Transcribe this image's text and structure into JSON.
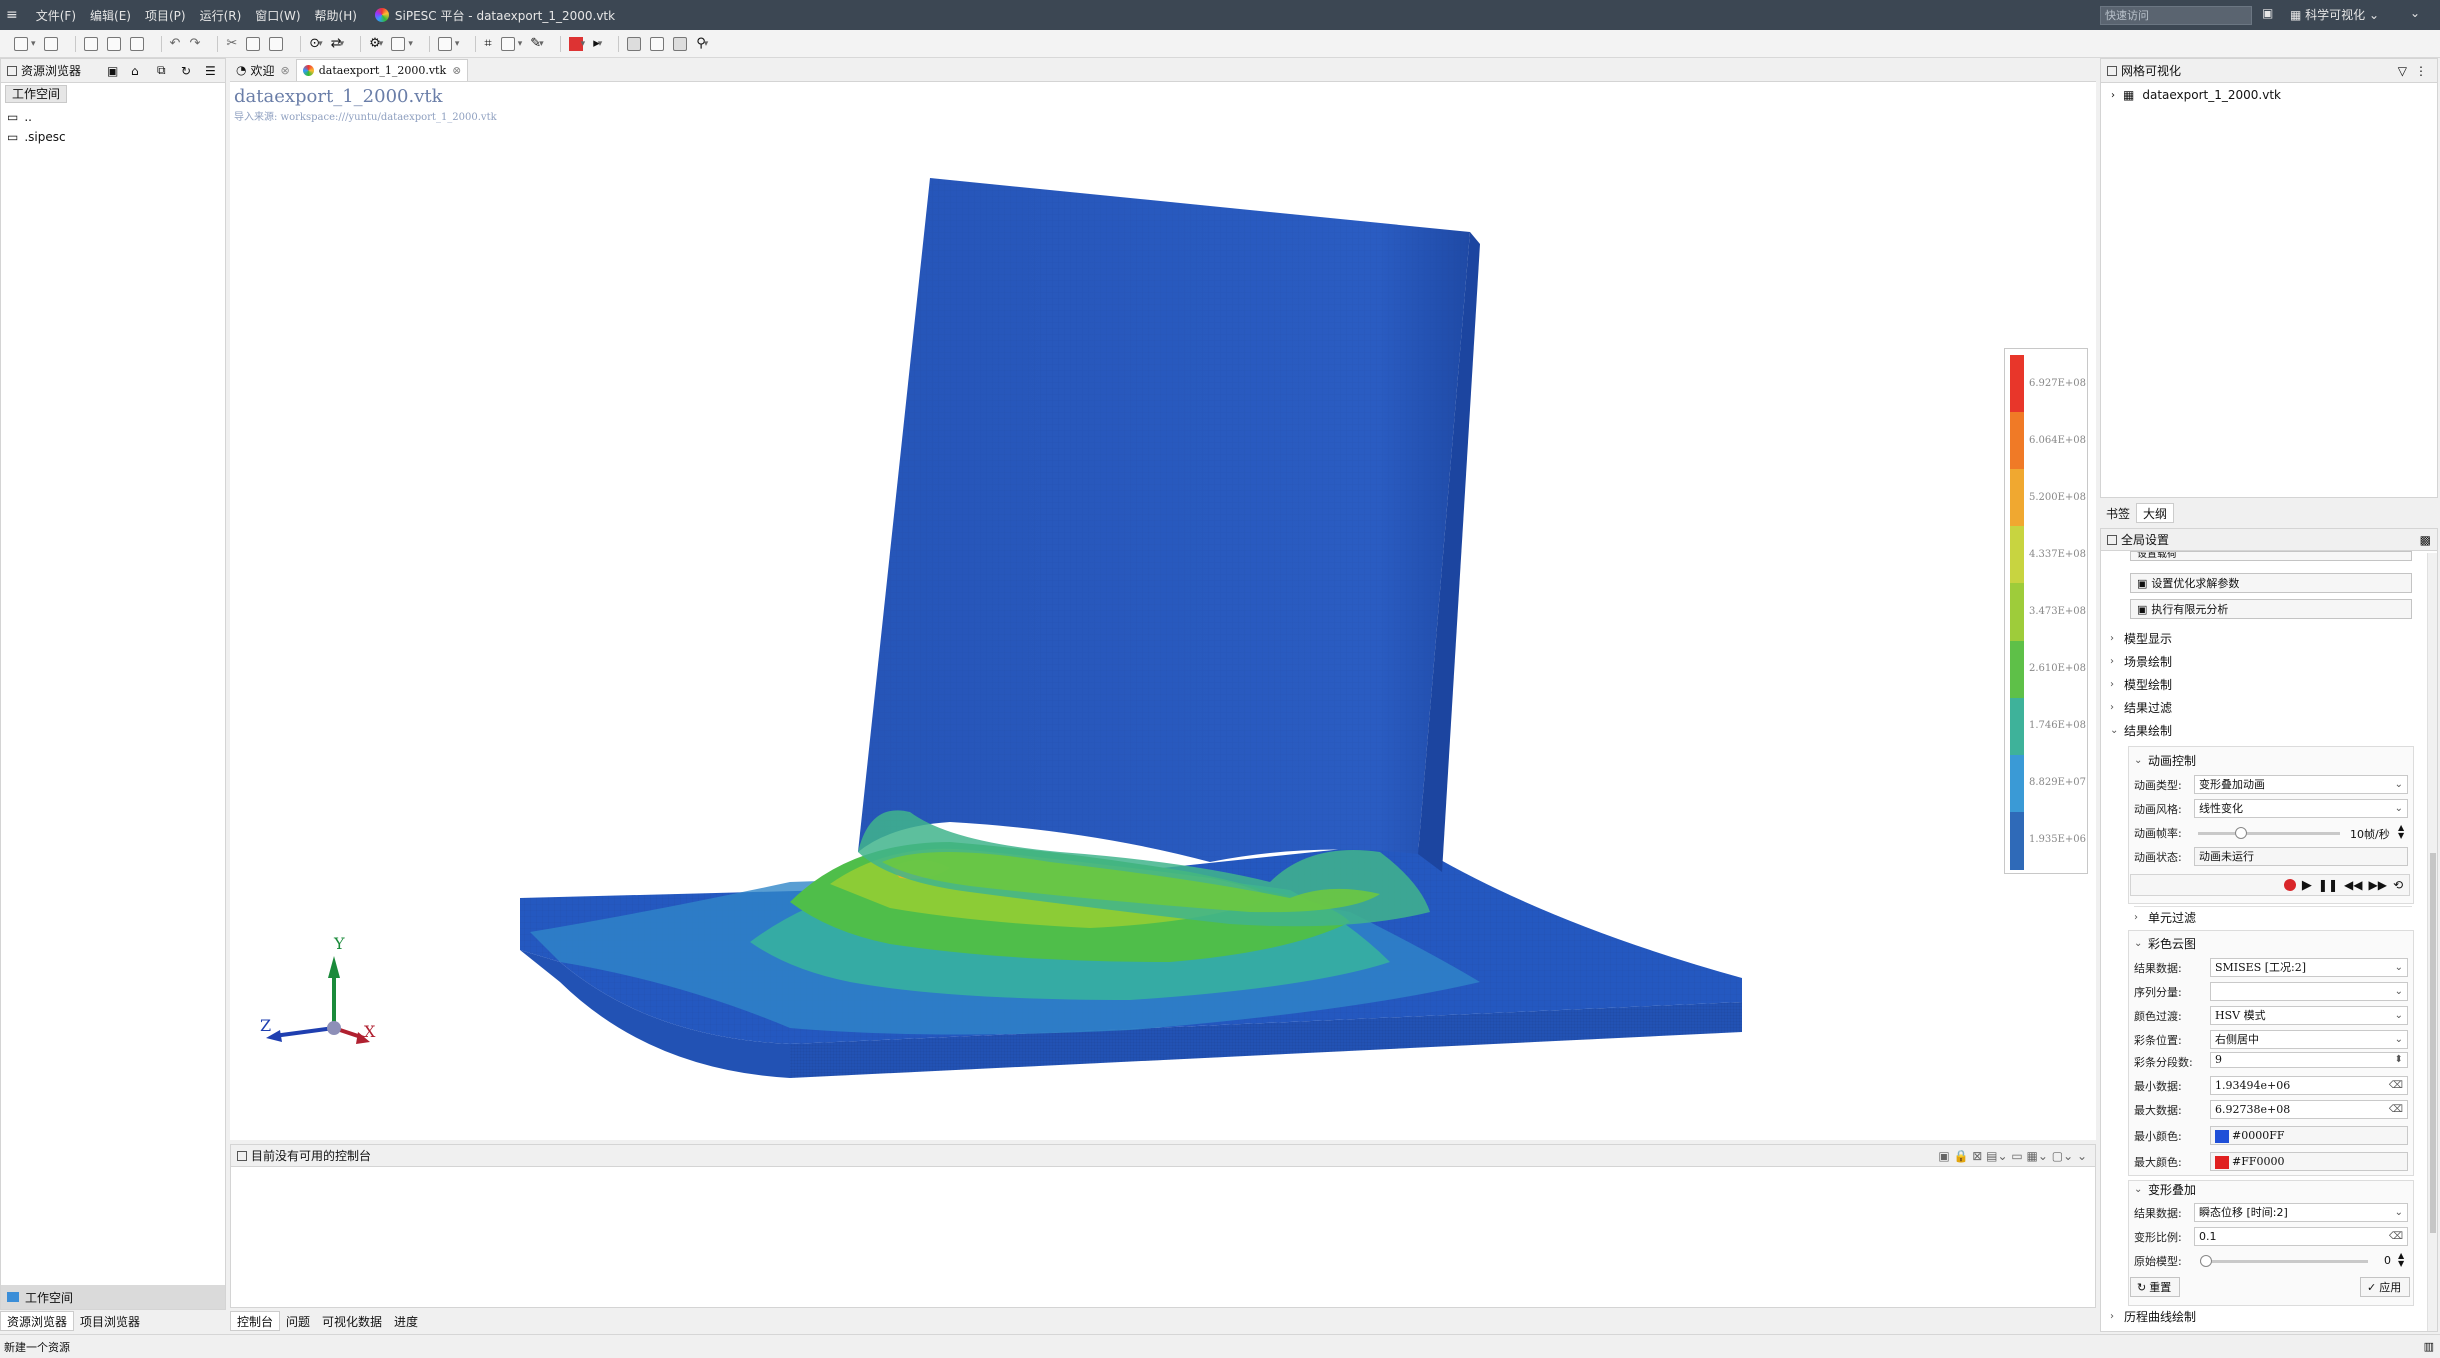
{
  "titlebar": {
    "menus": [
      "文件(F)",
      "编辑(E)",
      "项目(P)",
      "运行(R)",
      "窗口(W)",
      "帮助(H)"
    ],
    "title": "SiPESC 平台 - dataexport_1_2000.vtk",
    "search_placeholder": "快速访问",
    "perspective": "科学可视化"
  },
  "left_panel": {
    "tab_label": "资源浏览器",
    "workspace_label": "工作空间",
    "tree_items": [
      "..",
      ".sipesc"
    ],
    "bottom_workspace": "工作空间",
    "bottom_tabs": [
      "资源浏览器",
      "项目浏览器"
    ]
  },
  "editor_tabs": [
    {
      "label": "欢迎"
    },
    {
      "label": "dataexport_1_2000.vtk"
    }
  ],
  "viewport": {
    "file_title": "dataexport_1_2000.vtk",
    "source": "导入来源: workspace:///yuntu/dataexport_1_2000.vtk",
    "axes": {
      "x": "X",
      "y": "Y",
      "z": "Z"
    },
    "legend_labels": [
      "6.927E+08",
      "6.064E+08",
      "5.200E+08",
      "4.337E+08",
      "3.473E+08",
      "2.610E+08",
      "1.746E+08",
      "8.829E+07",
      "1.935E+06"
    ],
    "legend_colors": [
      "#e8362a",
      "#f07a26",
      "#f0a830",
      "#c8d440",
      "#9ecc3a",
      "#5ec048",
      "#3eb29a",
      "#3a9ad6",
      "#2f6ab8"
    ]
  },
  "console": {
    "message": "目前没有可用的控制台",
    "tabs": [
      "控制台",
      "问题",
      "可视化数据",
      "进度"
    ]
  },
  "right_panel": {
    "tab_label": "网格可视化",
    "tree_item": "dataexport_1_2000.vtk",
    "sub_tabs": [
      "书签",
      "大纲"
    ],
    "global_settings": "全局设置",
    "partial_item": "设置载荷",
    "action_buttons": [
      "设置优化求解参数",
      "执行有限元分析"
    ],
    "sections": [
      "模型显示",
      "场景绘制",
      "模型绘制",
      "结果过滤",
      "结果绘制"
    ],
    "animation": {
      "title": "动画控制",
      "type_label": "动画类型:",
      "type_value": "变形叠加动画",
      "style_label": "动画风格:",
      "style_value": "线性变化",
      "rate_label": "动画帧率:",
      "rate_value": "10帧/秒",
      "rate_fraction": 0.3,
      "status_label": "动画状态:",
      "status_value": "动画未运行"
    },
    "element_filter": "单元过滤",
    "contour": {
      "title": "彩色云图",
      "rows": [
        {
          "label": "结果数据:",
          "value": "SMISES [工况:2]"
        },
        {
          "label": "序列分量:",
          "value": ""
        },
        {
          "label": "颜色过渡:",
          "value": "HSV 模式"
        },
        {
          "label": "彩条位置:",
          "value": "右侧居中"
        },
        {
          "label": "彩条分段数:",
          "value": "9"
        },
        {
          "label": "最小数据:",
          "value": "1.93494e+06"
        },
        {
          "label": "最大数据:",
          "value": "6.92738e+08"
        },
        {
          "label": "最小颜色:",
          "value": "#0000FF"
        },
        {
          "label": "最大颜色:",
          "value": "#FF0000"
        }
      ],
      "min_color": "#1f4fd8",
      "max_color": "#e02020"
    },
    "deform": {
      "title": "变形叠加",
      "data_label": "结果数据:",
      "data_value": "瞬态位移 [时间:2]",
      "scale_label": "变形比例:",
      "scale_value": "0.1",
      "orig_label": "原始模型:",
      "orig_value": "0",
      "orig_fraction": 0.0
    },
    "reset_label": "重置",
    "apply_label": "应用",
    "history": "历程曲线绘制"
  },
  "status": {
    "text": "新建一个资源"
  }
}
